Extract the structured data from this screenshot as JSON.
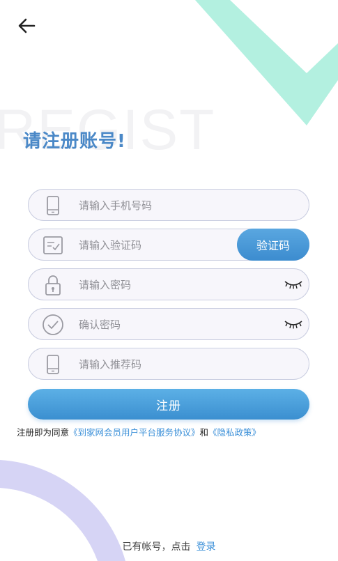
{
  "header": {
    "back_icon": "arrow-left-icon"
  },
  "title": {
    "watermark": "REGIST",
    "heading": "请注册账号!"
  },
  "form": {
    "phone": {
      "placeholder": "请输入手机号码",
      "icon": "phone-icon"
    },
    "code": {
      "placeholder": "请输入验证码",
      "icon": "message-check-icon",
      "button_label": "验证码"
    },
    "password": {
      "placeholder": "请输入密码",
      "icon": "lock-icon",
      "toggle_icon": "eye-closed-icon"
    },
    "confirm": {
      "placeholder": "确认密码",
      "icon": "check-circle-icon",
      "toggle_icon": "eye-closed-icon"
    },
    "referral": {
      "placeholder": "请输入推荐码",
      "icon": "phone-icon"
    },
    "submit_label": "注册"
  },
  "agreement": {
    "prefix": "注册即为同意",
    "service_link": "《到家网会员用户平台服务协议》",
    "conjunction": "和",
    "privacy_link": "《隐私政策》"
  },
  "footer": {
    "prompt": "已有帐号，点击",
    "login_link": "登录"
  },
  "colors": {
    "accent": "#3a8fd8",
    "deco_green": "#b3f0e0",
    "deco_purple": "#d6d4f5"
  }
}
